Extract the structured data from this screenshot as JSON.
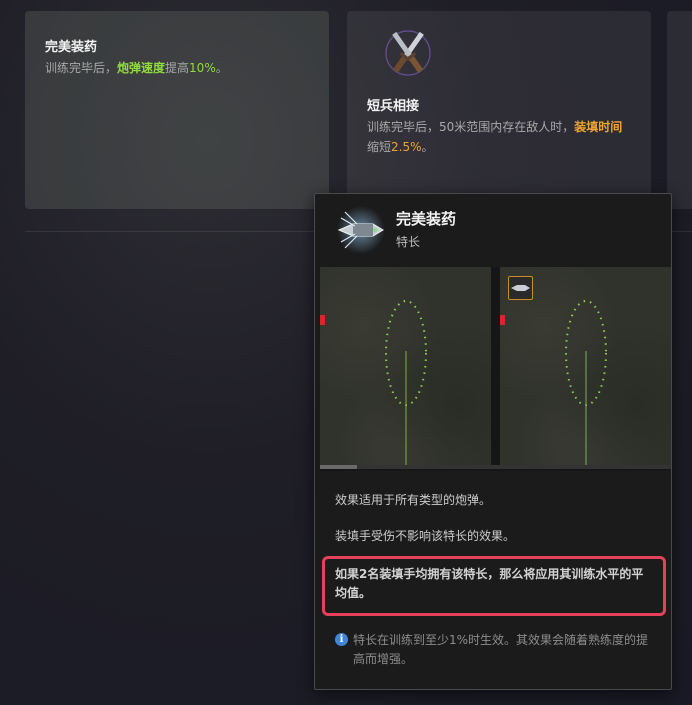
{
  "cards": [
    {
      "title": "完美装药",
      "desc_prefix": "训练完毕后，",
      "desc_highlight": "炮弹速度",
      "desc_mid": "提高",
      "desc_number": "10%",
      "desc_suffix": "。"
    },
    {
      "title": "短兵相接",
      "desc_prefix": "训练完毕后，50米范围内存在敌人时，",
      "desc_highlight": "装填时间",
      "desc_mid": "缩短",
      "desc_number": "2.5%",
      "desc_suffix": "。"
    }
  ],
  "tooltip": {
    "title": "完美装药",
    "subtitle": "特长",
    "media_progress": 0.105,
    "lines": [
      "效果适用于所有类型的炮弹。",
      "装填手受伤不影响该特长的效果。"
    ],
    "highlight_text": "如果2名装填手均拥有该特长，那么将应用其训练水平的平均值。",
    "info_icon_glyph": "i",
    "info_text": "特长在训练到至少1%时生效。其效果会随着熟练度的提高而增强。"
  },
  "colors": {
    "highlight_green": "#8fdc3c",
    "highlight_orange": "#f0a42e",
    "callout_border": "#e5415a",
    "info_blue": "#3f85d8"
  }
}
